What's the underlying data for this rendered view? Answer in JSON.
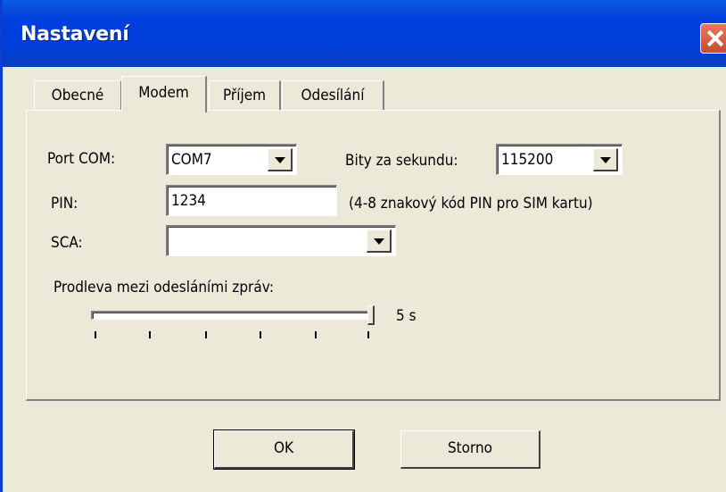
{
  "window": {
    "title": "Nastavení"
  },
  "tabs": [
    {
      "label": "Obecné",
      "active": false
    },
    {
      "label": "Modem",
      "active": true
    },
    {
      "label": "Příjem",
      "active": false
    },
    {
      "label": "Odesílání",
      "active": false
    }
  ],
  "modem": {
    "port_label": "Port COM:",
    "port_value": "COM7",
    "baud_label": "Bity za sekundu:",
    "baud_value": "115200",
    "pin_label": "PIN:",
    "pin_value": "1234",
    "pin_hint": "(4-8 znakový kód PIN pro SIM kartu)",
    "sca_label": "SCA:",
    "sca_value": "",
    "delay_label": "Prodleva mezi odesláními zpráv:",
    "delay_value": "5 s"
  },
  "buttons": {
    "ok": "OK",
    "cancel": "Storno"
  }
}
